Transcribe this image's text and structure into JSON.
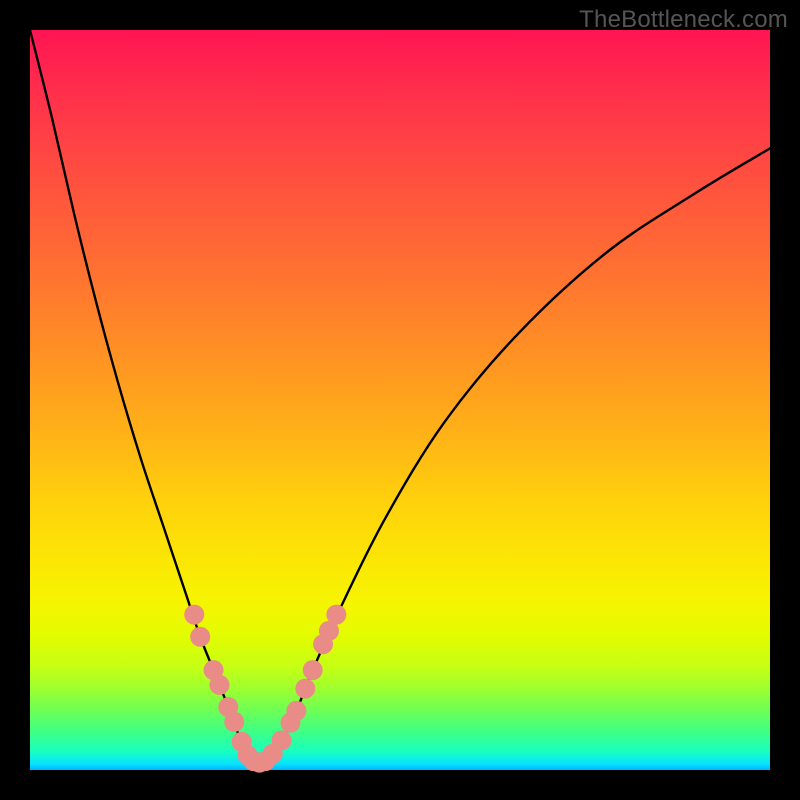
{
  "watermark": "TheBottleneck.com",
  "chart_data": {
    "type": "line",
    "title": "",
    "xlabel": "",
    "ylabel": "",
    "xlim": [
      0,
      100
    ],
    "ylim": [
      0,
      100
    ],
    "series": [
      {
        "name": "bottleneck-curve",
        "x": [
          0,
          3,
          6,
          9,
          12,
          15,
          18,
          21,
          23,
          25,
          27,
          28.5,
          30,
          31,
          32,
          34,
          36,
          38,
          42,
          48,
          56,
          66,
          78,
          90,
          100
        ],
        "y": [
          100,
          88,
          75,
          63,
          52,
          42,
          33,
          24,
          18,
          13,
          8,
          4,
          1.5,
          1,
          1.5,
          4,
          8,
          13,
          22,
          34,
          47,
          59,
          70,
          78,
          84
        ]
      }
    ],
    "markers": {
      "name": "highlight-dots",
      "color": "#e98b86",
      "radius": 10,
      "points": [
        {
          "x": 22.2,
          "y": 21.0
        },
        {
          "x": 23.0,
          "y": 18.0
        },
        {
          "x": 24.8,
          "y": 13.5
        },
        {
          "x": 25.6,
          "y": 11.5
        },
        {
          "x": 26.8,
          "y": 8.5
        },
        {
          "x": 27.6,
          "y": 6.5
        },
        {
          "x": 28.6,
          "y": 3.8
        },
        {
          "x": 29.4,
          "y": 2.0
        },
        {
          "x": 30.2,
          "y": 1.2
        },
        {
          "x": 31.0,
          "y": 1.0
        },
        {
          "x": 31.8,
          "y": 1.2
        },
        {
          "x": 32.8,
          "y": 2.2
        },
        {
          "x": 34.0,
          "y": 4.0
        },
        {
          "x": 35.2,
          "y": 6.4
        },
        {
          "x": 36.0,
          "y": 8.0
        },
        {
          "x": 37.2,
          "y": 11.0
        },
        {
          "x": 38.2,
          "y": 13.5
        },
        {
          "x": 39.6,
          "y": 17.0
        },
        {
          "x": 40.4,
          "y": 18.8
        },
        {
          "x": 41.4,
          "y": 21.0
        }
      ]
    },
    "gradient_stops": [
      {
        "pos": 0.0,
        "color": "#ff1452"
      },
      {
        "pos": 0.5,
        "color": "#ffb018"
      },
      {
        "pos": 0.8,
        "color": "#f4f600"
      },
      {
        "pos": 0.92,
        "color": "#6cff56"
      },
      {
        "pos": 1.0,
        "color": "#00b4ff"
      }
    ]
  }
}
